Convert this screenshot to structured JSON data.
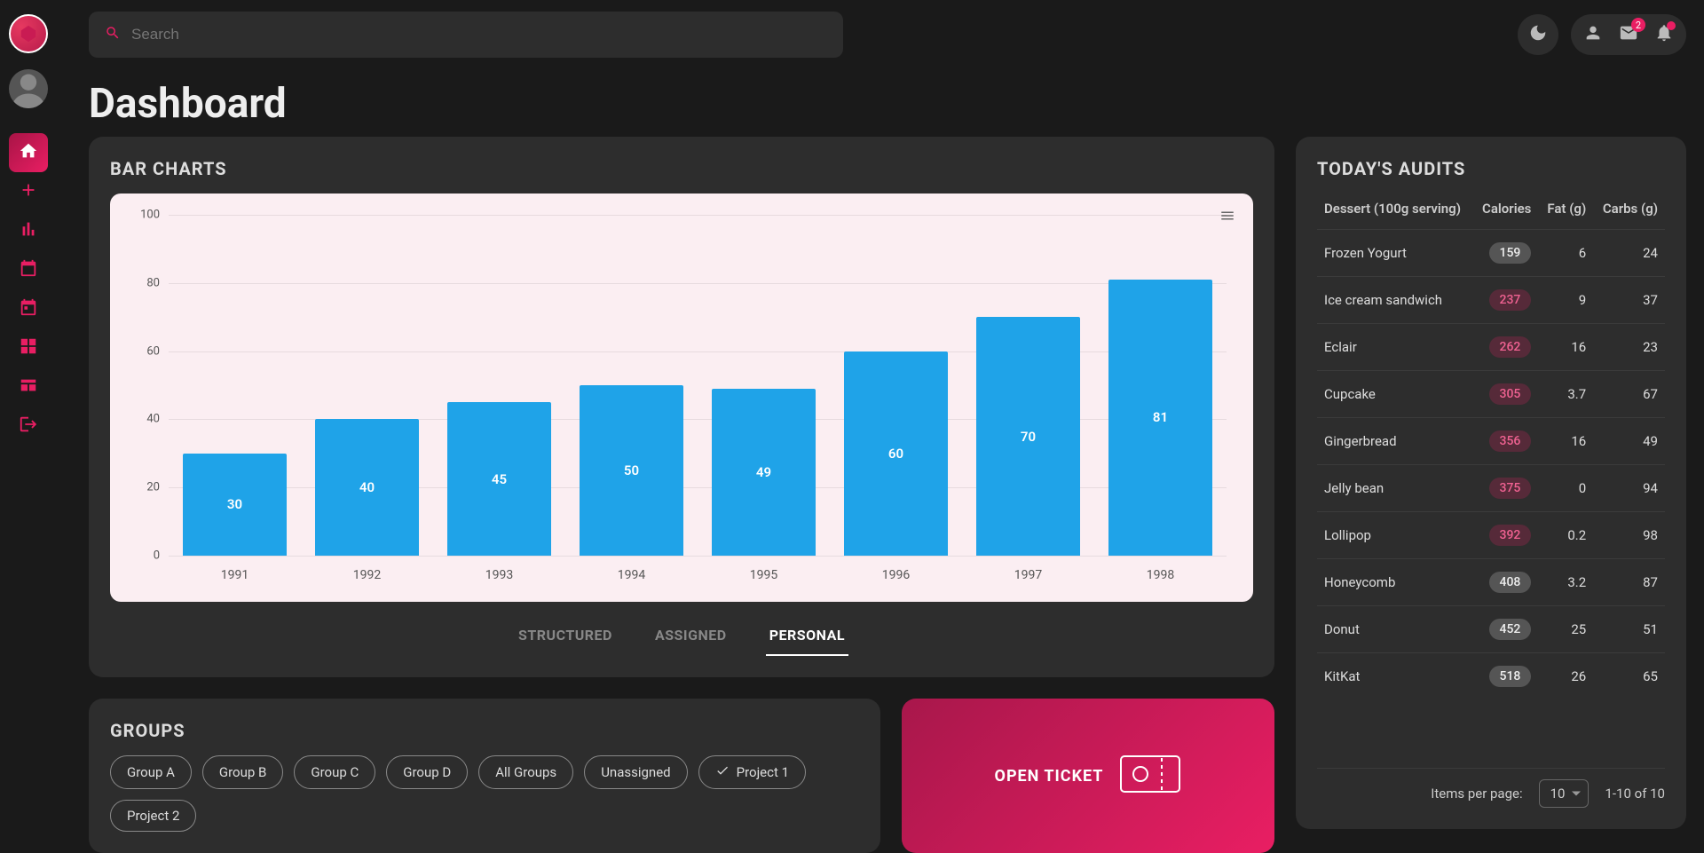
{
  "search": {
    "placeholder": "Search"
  },
  "header": {
    "title": "Dashboard",
    "mail_badge": "2"
  },
  "sidebar": {
    "nav": [
      {
        "name": "home",
        "active": true
      },
      {
        "name": "plus"
      },
      {
        "name": "stats"
      },
      {
        "name": "calendar"
      },
      {
        "name": "calendar2"
      },
      {
        "name": "grid"
      },
      {
        "name": "panel"
      },
      {
        "name": "logout"
      }
    ]
  },
  "chart_card": {
    "title": "BAR CHARTS",
    "tabs": [
      "STRUCTURED",
      "ASSIGNED",
      "PERSONAL"
    ],
    "active_tab": 2
  },
  "chart_data": {
    "type": "bar",
    "categories": [
      "1991",
      "1992",
      "1993",
      "1994",
      "1995",
      "1996",
      "1997",
      "1998"
    ],
    "values": [
      30,
      40,
      45,
      50,
      49,
      60,
      70,
      81
    ],
    "ylim": [
      0,
      100
    ],
    "yticks": [
      0,
      20,
      40,
      60,
      80,
      100
    ],
    "title": "",
    "xlabel": "",
    "ylabel": ""
  },
  "groups": {
    "title": "GROUPS",
    "chips": [
      {
        "label": "Group A",
        "checked": false
      },
      {
        "label": "Group B",
        "checked": false
      },
      {
        "label": "Group C",
        "checked": false
      },
      {
        "label": "Group D",
        "checked": false
      },
      {
        "label": "All Groups",
        "checked": false
      },
      {
        "label": "Unassigned",
        "checked": false
      },
      {
        "label": "Project 1",
        "checked": true
      },
      {
        "label": "Project 2",
        "checked": false
      }
    ]
  },
  "ticket": {
    "label": "OPEN TICKET"
  },
  "audits": {
    "title": "TODAY'S AUDITS",
    "columns": [
      "Dessert (100g serving)",
      "Calories",
      "Fat (g)",
      "Carbs (g)"
    ],
    "rows": [
      {
        "name": "Frozen Yogurt",
        "cal": 159,
        "fat": "6",
        "carbs": "24",
        "high": false
      },
      {
        "name": "Ice cream sandwich",
        "cal": 237,
        "fat": "9",
        "carbs": "37",
        "high": true
      },
      {
        "name": "Eclair",
        "cal": 262,
        "fat": "16",
        "carbs": "23",
        "high": true
      },
      {
        "name": "Cupcake",
        "cal": 305,
        "fat": "3.7",
        "carbs": "67",
        "high": true
      },
      {
        "name": "Gingerbread",
        "cal": 356,
        "fat": "16",
        "carbs": "49",
        "high": true
      },
      {
        "name": "Jelly bean",
        "cal": 375,
        "fat": "0",
        "carbs": "94",
        "high": true
      },
      {
        "name": "Lollipop",
        "cal": 392,
        "fat": "0.2",
        "carbs": "98",
        "high": true
      },
      {
        "name": "Honeycomb",
        "cal": 408,
        "fat": "3.2",
        "carbs": "87",
        "high": false
      },
      {
        "name": "Donut",
        "cal": 452,
        "fat": "25",
        "carbs": "51",
        "high": false
      },
      {
        "name": "KitKat",
        "cal": 518,
        "fat": "26",
        "carbs": "65",
        "high": false
      }
    ],
    "pager": {
      "label": "Items per page:",
      "per_page": "10",
      "range": "1-10 of 10"
    }
  }
}
